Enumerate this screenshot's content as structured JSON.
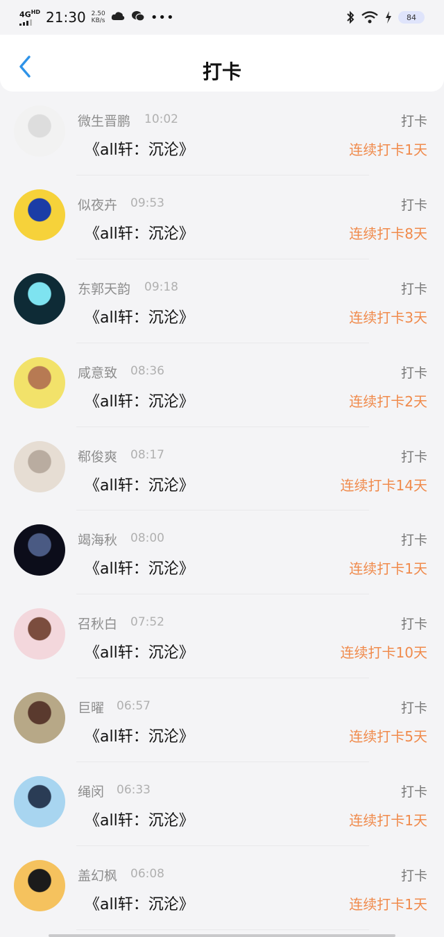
{
  "status_bar": {
    "network": "4G",
    "network_sup": "HD",
    "time": "21:30",
    "speed": "2.50",
    "speed_unit": "KB/s",
    "battery": "84"
  },
  "header": {
    "title": "打卡"
  },
  "entries": [
    {
      "name": "微生晋鹏",
      "time": "10:02",
      "book": "《all轩：沉沦》",
      "type": "打卡",
      "streak": "连续打卡1天",
      "avatar_colors": [
        "#f2f2f2",
        "#ddd"
      ]
    },
    {
      "name": "似夜卉",
      "time": "09:53",
      "book": "《all轩：沉沦》",
      "type": "打卡",
      "streak": "连续打卡8天",
      "avatar_colors": [
        "#f6d23a",
        "#1b3da6"
      ]
    },
    {
      "name": "东郭天韵",
      "time": "09:18",
      "book": "《all轩：沉沦》",
      "type": "打卡",
      "streak": "连续打卡3天",
      "avatar_colors": [
        "#0e2b36",
        "#7ee3f0"
      ]
    },
    {
      "name": "咸意致",
      "time": "08:36",
      "book": "《all轩：沉沦》",
      "type": "打卡",
      "streak": "连续打卡2天",
      "avatar_colors": [
        "#f2e26a",
        "#b77a53"
      ]
    },
    {
      "name": "郗俊爽",
      "time": "08:17",
      "book": "《all轩：沉沦》",
      "type": "打卡",
      "streak": "连续打卡14天",
      "avatar_colors": [
        "#e6ddd3",
        "#b9aca0"
      ]
    },
    {
      "name": "竭海秋",
      "time": "08:00",
      "book": "《all轩：沉沦》",
      "type": "打卡",
      "streak": "连续打卡1天",
      "avatar_colors": [
        "#0c0d1a",
        "#4a5a83"
      ]
    },
    {
      "name": "召秋白",
      "time": "07:52",
      "book": "《all轩：沉沦》",
      "type": "打卡",
      "streak": "连续打卡10天",
      "avatar_colors": [
        "#f3d7dc",
        "#7b4d3e"
      ]
    },
    {
      "name": "巨曜",
      "time": "06:57",
      "book": "《all轩：沉沦》",
      "type": "打卡",
      "streak": "连续打卡5天",
      "avatar_colors": [
        "#b7a887",
        "#5a3a2e"
      ]
    },
    {
      "name": "绳闵",
      "time": "06:33",
      "book": "《all轩：沉沦》",
      "type": "打卡",
      "streak": "连续打卡1天",
      "avatar_colors": [
        "#a8d5f0",
        "#2a3c55"
      ]
    },
    {
      "name": "盖幻枫",
      "time": "06:08",
      "book": "《all轩：沉沦》",
      "type": "打卡",
      "streak": "连续打卡1天",
      "avatar_colors": [
        "#f5c25e",
        "#1b1b1b"
      ]
    }
  ]
}
